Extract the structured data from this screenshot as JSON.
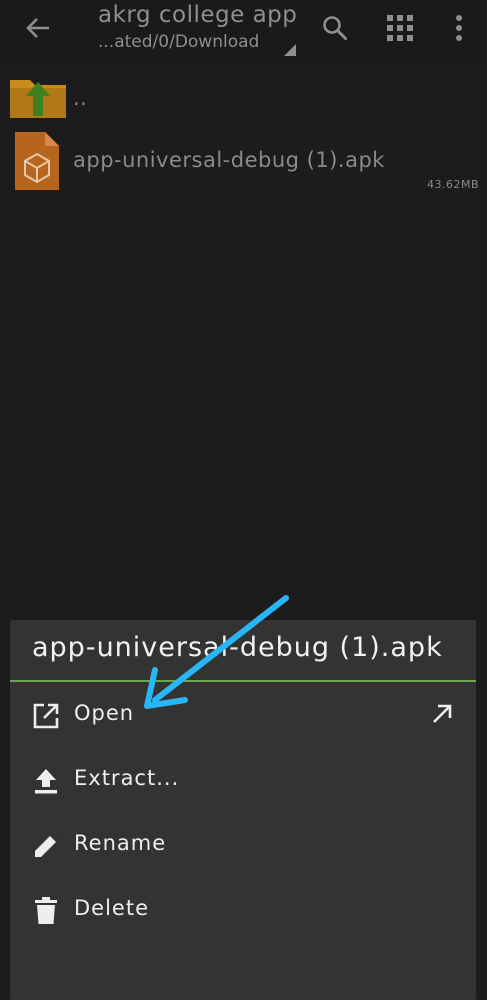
{
  "toolbar": {
    "title": "akrg college app",
    "path": "...ated/0/Download",
    "icons": [
      "back-arrow-icon",
      "search-icon",
      "grid-view-icon",
      "more-vert-icon"
    ]
  },
  "files": {
    "parent_label": "..",
    "items": [
      {
        "name": "app-universal-debug (1).apk",
        "size": "43.62MB",
        "icon": "apk-package-icon"
      }
    ]
  },
  "sheet": {
    "title": "app-universal-debug (1).apk",
    "items": [
      {
        "label": "Open",
        "icon": "open-external-icon",
        "trailing_icon": "arrow-up-right-icon"
      },
      {
        "label": "Extract...",
        "icon": "upload-icon"
      },
      {
        "label": "Rename",
        "icon": "pencil-icon"
      },
      {
        "label": "Delete",
        "icon": "trash-icon"
      }
    ]
  },
  "colors": {
    "background": "#1c1c1c",
    "sheet": "#333333",
    "divider": "#6aa84f",
    "annotation": "#29b6f6",
    "folder": "#c98a1e",
    "apk_file": "#b5651d"
  }
}
